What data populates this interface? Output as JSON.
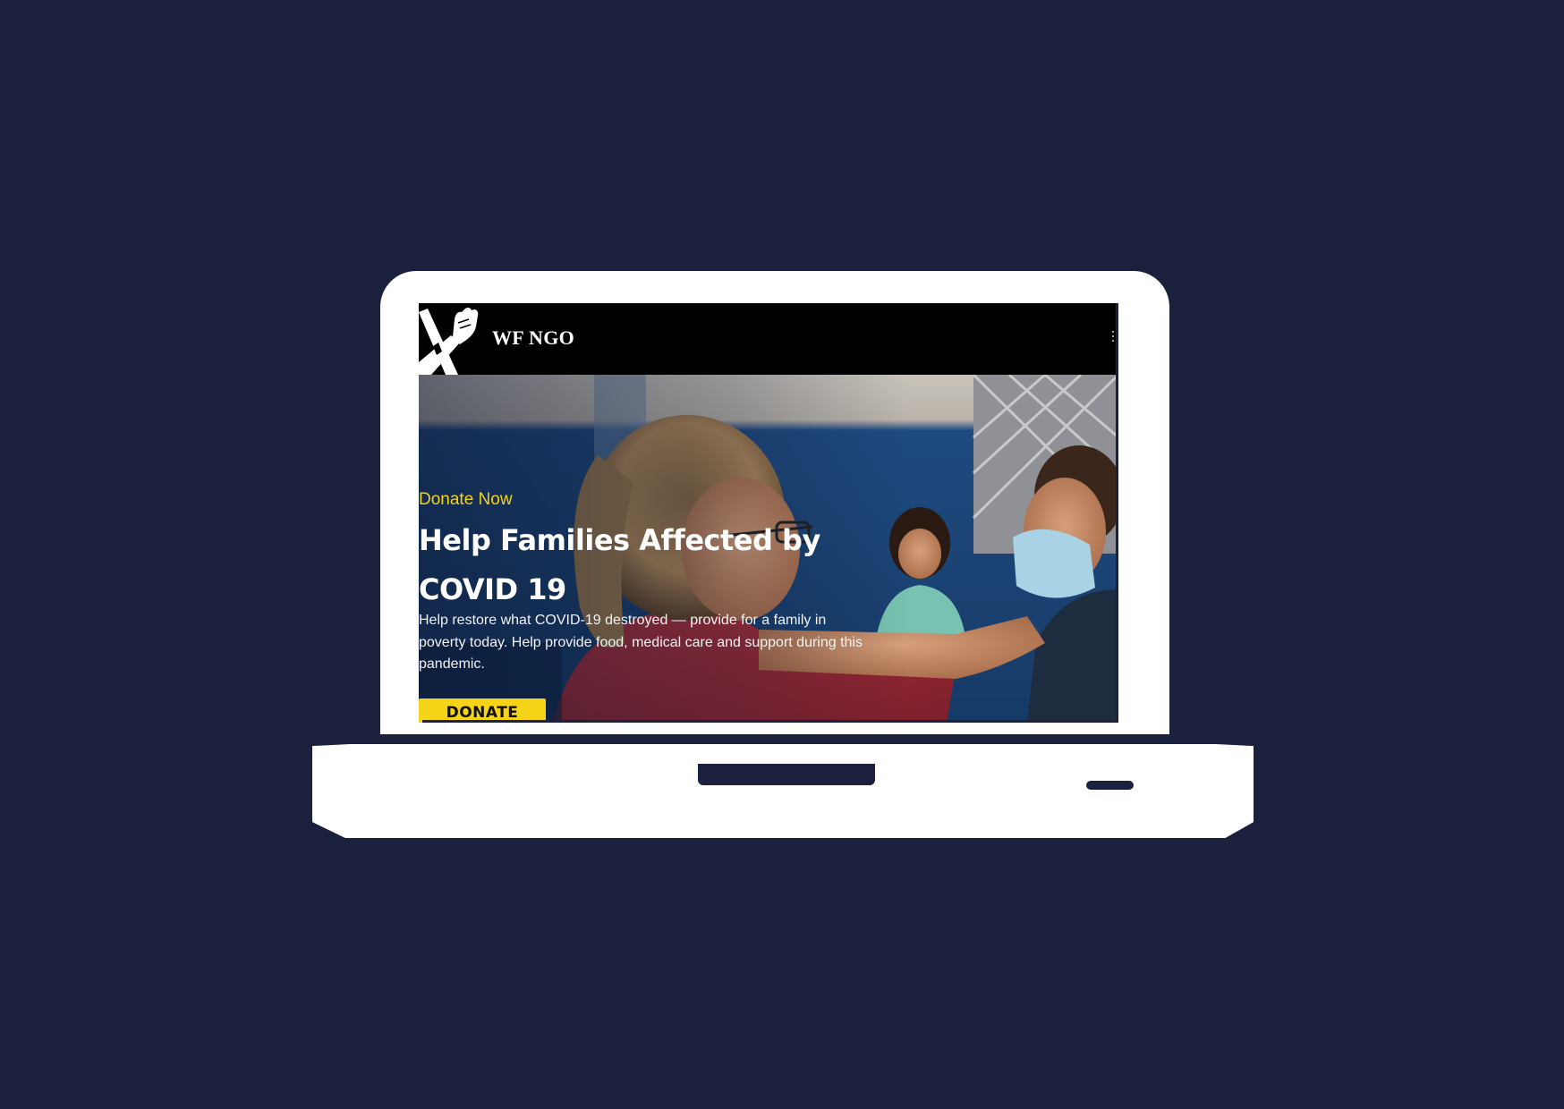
{
  "colors": {
    "page_background": "#1b213d",
    "header_background": "#000000",
    "accent": "#f5d316",
    "eyebrow_text": "#f3d21b",
    "device_body": "#ffffff"
  },
  "header": {
    "brand_name": "WF NGO",
    "logo_icon": "raised-fist-logo",
    "menu_icon": "more-vertical-icon"
  },
  "hero": {
    "image": "photo of a woman caring for a masked child with another child in background",
    "eyebrow": "Donate Now",
    "headline": "Help Families Affected by COVID 19",
    "body": "Help restore what COVID-19 destroyed — provide for a family in poverty today. Help provide food, medical care and support during this pandemic.",
    "cta_label": "DONATE"
  }
}
